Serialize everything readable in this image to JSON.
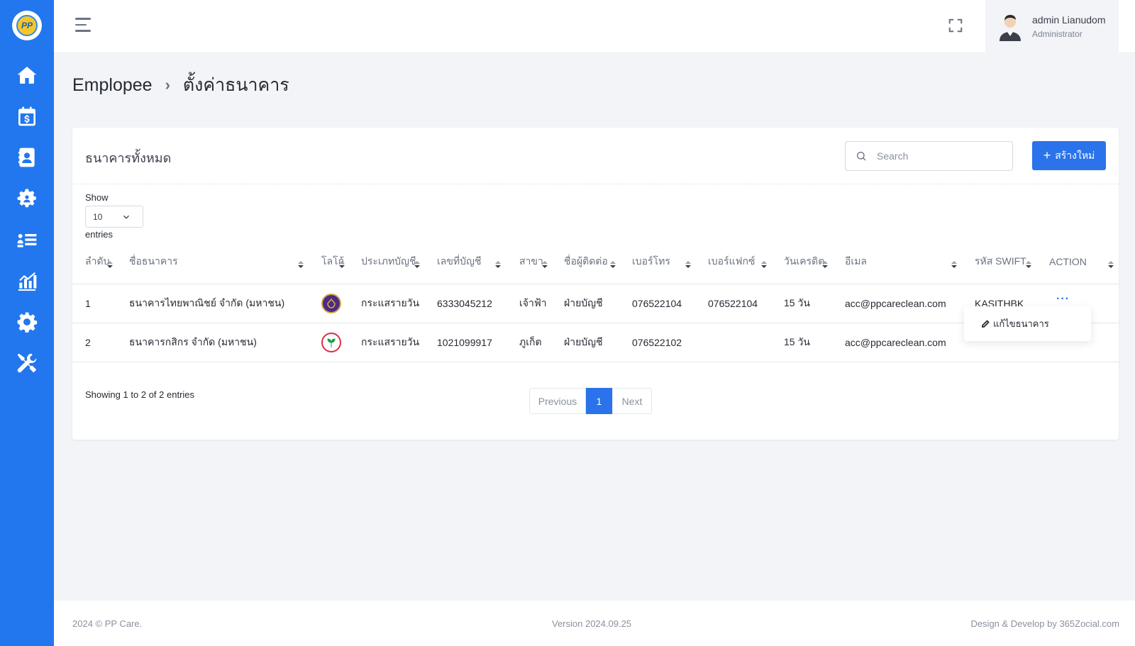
{
  "app": {
    "logo_text": "PP"
  },
  "sidebar": {
    "items": [
      {
        "name": "home-icon"
      },
      {
        "name": "calendar-dollar-icon"
      },
      {
        "name": "contacts-book-icon"
      },
      {
        "name": "team-gear-icon"
      },
      {
        "name": "user-list-icon"
      },
      {
        "name": "chart-icon"
      },
      {
        "name": "settings-gear-icon"
      },
      {
        "name": "tools-icon"
      }
    ],
    "accent": "#2277ee"
  },
  "header": {
    "user_name": "admin Lianudom",
    "user_role": "Administrator"
  },
  "breadcrumb": {
    "root": "Emplopee",
    "current": "ตั้งค่าธนาคาร"
  },
  "card": {
    "title": "ธนาคารทั้งหมด",
    "search_placeholder": "Search",
    "create_label": "สร้างใหม่",
    "show_label": "Show",
    "entries_value": "10",
    "entries_label": "entries"
  },
  "table": {
    "columns": [
      "ลำดับ",
      "ชื่อธนาคาร",
      "โลโก้",
      "ประเภทบัญชี",
      "เลขที่บัญชี",
      "สาขา",
      "ชื่อผู้ติดต่อ",
      "เบอร์โทร",
      "เบอร์แฟกซ์",
      "วันเครดิต",
      "อีเมล",
      "รหัส SWIFT",
      "ACTION"
    ],
    "rows": [
      {
        "no": "1",
        "bank": "ธนาคารไทยพาณิชย์ จำกัด (มหาชน)",
        "logo": "scb-logo",
        "type": "กระแสรายวัน",
        "account": "6333045212",
        "branch": "เจ้าฟ้า",
        "contact": "ฝ่ายบัญชี",
        "phone": "076522104",
        "fax": "076522104",
        "credit": "15 วัน",
        "email": "acc@ppcareclean.com",
        "swift": "KASITHBK",
        "action": "···"
      },
      {
        "no": "2",
        "bank": "ธนาคารกสิกร จำกัด (มหาชน)",
        "logo": "kbank-logo",
        "type": "กระแสรายวัน",
        "account": "1021099917",
        "branch": "ภูเก็ต",
        "contact": "ฝ่ายบัญชี",
        "phone": "076522102",
        "fax": "",
        "credit": "15 วัน",
        "email": "acc@ppcareclean.com",
        "swift": "",
        "action": ""
      }
    ]
  },
  "dropdown": {
    "edit_label": "แก้ไขธนาคาร"
  },
  "pagination": {
    "info_prefix": "Showing",
    "from": "1",
    "to_word": "to",
    "to": "2",
    "of_word": "of",
    "total": "2",
    "suffix": "entries",
    "prev": "Previous",
    "current": "1",
    "next": "Next"
  },
  "footer": {
    "copyright": "2024 © PP Care.",
    "version": "Version 2024.09.25",
    "credit": "Design & Develop by 365Zocial.com"
  }
}
